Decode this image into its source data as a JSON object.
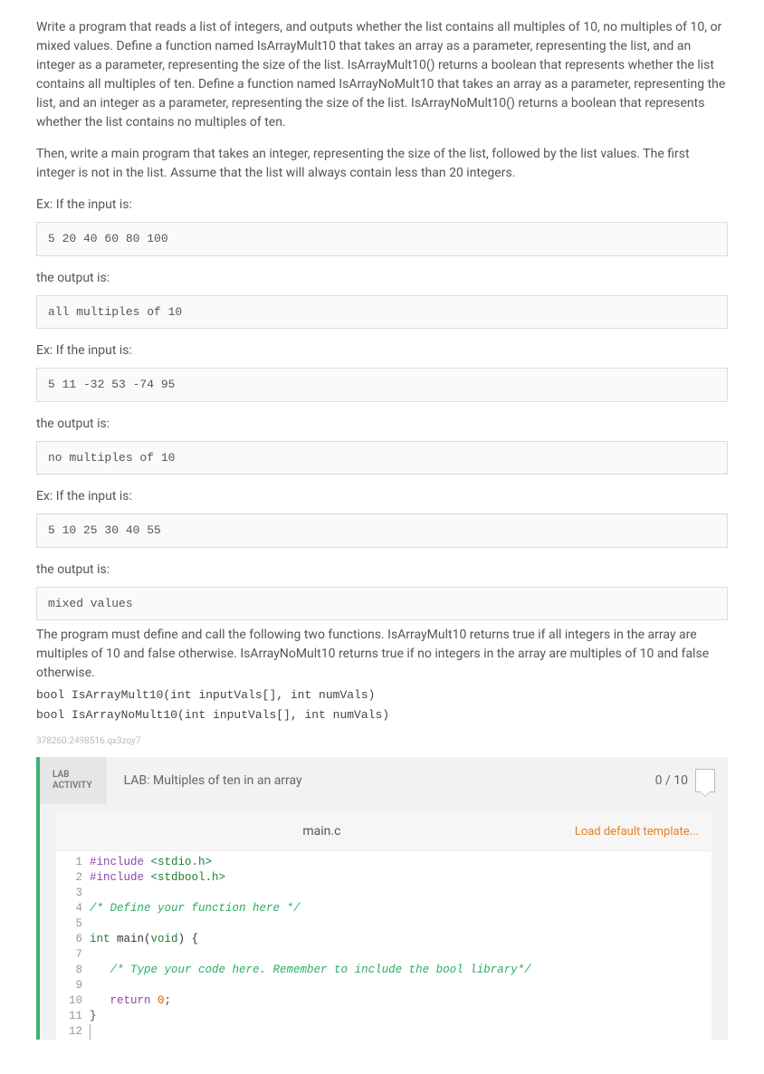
{
  "problem": {
    "para1": "Write a program that reads a list of integers, and outputs whether the list contains all multiples of 10, no multiples of 10, or mixed values. Define a function named IsArrayMult10 that takes an array as a parameter, representing the list, and an integer as a parameter, representing the size of the list. IsArrayMult10() returns a boolean that represents whether the list contains all multiples of ten. Define a function named IsArrayNoMult10 that takes an array as a parameter, representing the list, and an integer as a parameter, representing the size of the list. IsArrayNoMult10() returns a boolean that represents whether the list contains no multiples of ten.",
    "para2": "Then, write a main program that takes an integer, representing the size of the list, followed by the list values. The first integer is not in the list. Assume that the list will always contain less than 20 integers.",
    "ex_label": "Ex: If the input is:",
    "output_label": "the output is:",
    "ex1_input": "5 20 40 60 80 100",
    "ex1_output": "all multiples of 10",
    "ex2_input": "5 11 -32 53 -74 95",
    "ex2_output": "no multiples of 10",
    "ex3_input": "5 10 25 30 40 55",
    "ex3_output": "mixed values",
    "footer_text": "The program must define and call the following two functions. IsArrayMult10 returns true if all integers in the array are multiples of 10 and false otherwise. IsArrayNoMult10 returns true if no integers in the array are multiples of 10 and false otherwise.",
    "sig1": "bool IsArrayMult10(int inputVals[], int numVals)",
    "sig2": "bool IsArrayNoMult10(int inputVals[], int numVals)"
  },
  "watermark": "378260.2498516.qx3zqy7",
  "lab": {
    "activity_line1": "LAB",
    "activity_line2": "ACTIVITY",
    "title": "LAB: Multiples of ten in an array",
    "score": "0 / 10"
  },
  "editor": {
    "filename": "main.c",
    "load_template": "Load default template...",
    "code": {
      "l1_a": "#include ",
      "l1_b": "<stdio.h>",
      "l2_a": "#include ",
      "l2_b": "<stdbool.h>",
      "l4": "/* Define your function here */",
      "l6_a": "int",
      "l6_b": " main(",
      "l6_c": "void",
      "l6_d": ") {",
      "l8": "   /* Type your code here. Remember to include the bool library*/",
      "l10_a": "   return ",
      "l10_b": "0",
      "l10_c": ";",
      "l11": "}"
    },
    "line_numbers": [
      "1",
      "2",
      "3",
      "4",
      "5",
      "6",
      "7",
      "8",
      "9",
      "10",
      "11",
      "12"
    ]
  }
}
